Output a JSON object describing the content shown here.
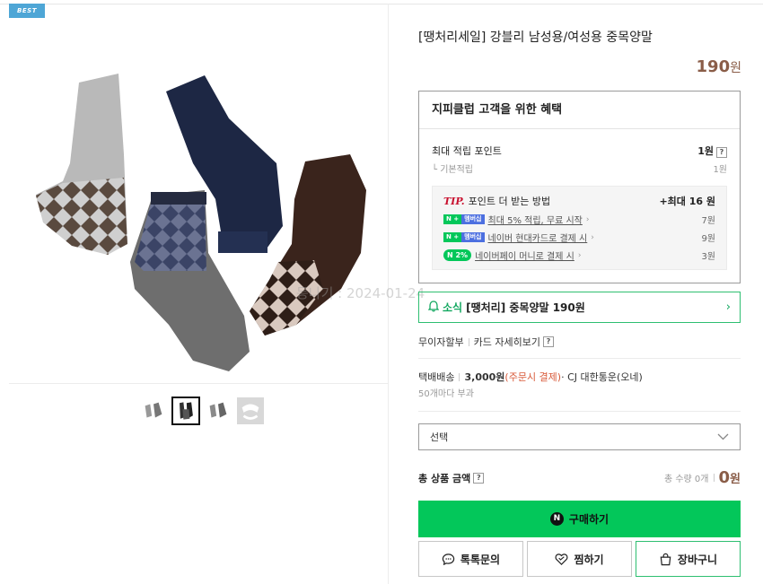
{
  "badge": "BEST",
  "product": {
    "title": "[땡처리세일] 강블리 남성용/여성용 중목양말",
    "price": "190",
    "price_unit": "원"
  },
  "benefits": {
    "title": "지피클럽 고객을 위한 혜택",
    "max_points_label": "최대 적립 포인트",
    "max_points_value": "1원",
    "help": "?",
    "basic_label": "기본적립",
    "basic_value": "1원",
    "tip_label": "TIP.",
    "tip_text": "포인트 더 받는 방법",
    "tip_max": "+최대 16 원",
    "tips": [
      {
        "badge_n": "N +",
        "badge_m": "멤버십",
        "label": "최대 5% 적립, 무료 시작",
        "value": "7원"
      },
      {
        "badge_n": "N +",
        "badge_m": "멤버십",
        "label": "네이버 현대카드로 결제 시",
        "value": "9원"
      },
      {
        "badge": "N 2%",
        "label": "네이버페이 머니로 결제 시",
        "value": "3원"
      }
    ]
  },
  "news": {
    "tag": "소식",
    "text": "[땡처리] 중목양말 190원"
  },
  "installment": {
    "label1": "무이자할부",
    "label2": "카드 자세히보기",
    "help": "?"
  },
  "shipping": {
    "type": "택배배송",
    "fee": "3,000원",
    "when": "(주문시 결제)",
    "carrier": "· CJ 대한통운(오네)",
    "note": "50개마다 부과"
  },
  "option_select": {
    "placeholder": "선택"
  },
  "total": {
    "label": "총 상품 금액",
    "help": "?",
    "qty": "총 수량 0개",
    "amount": "0",
    "unit": "원"
  },
  "buttons": {
    "buy": "구매하기",
    "talk": "톡톡문의",
    "wish": "찜하기",
    "cart": "장바구니"
  },
  "watermark": "등나기 : 2024-01-24",
  "colors": {
    "accent_green": "#03c75a",
    "price_brown": "#8a5d48",
    "badge_blue": "#4ea6d6"
  }
}
